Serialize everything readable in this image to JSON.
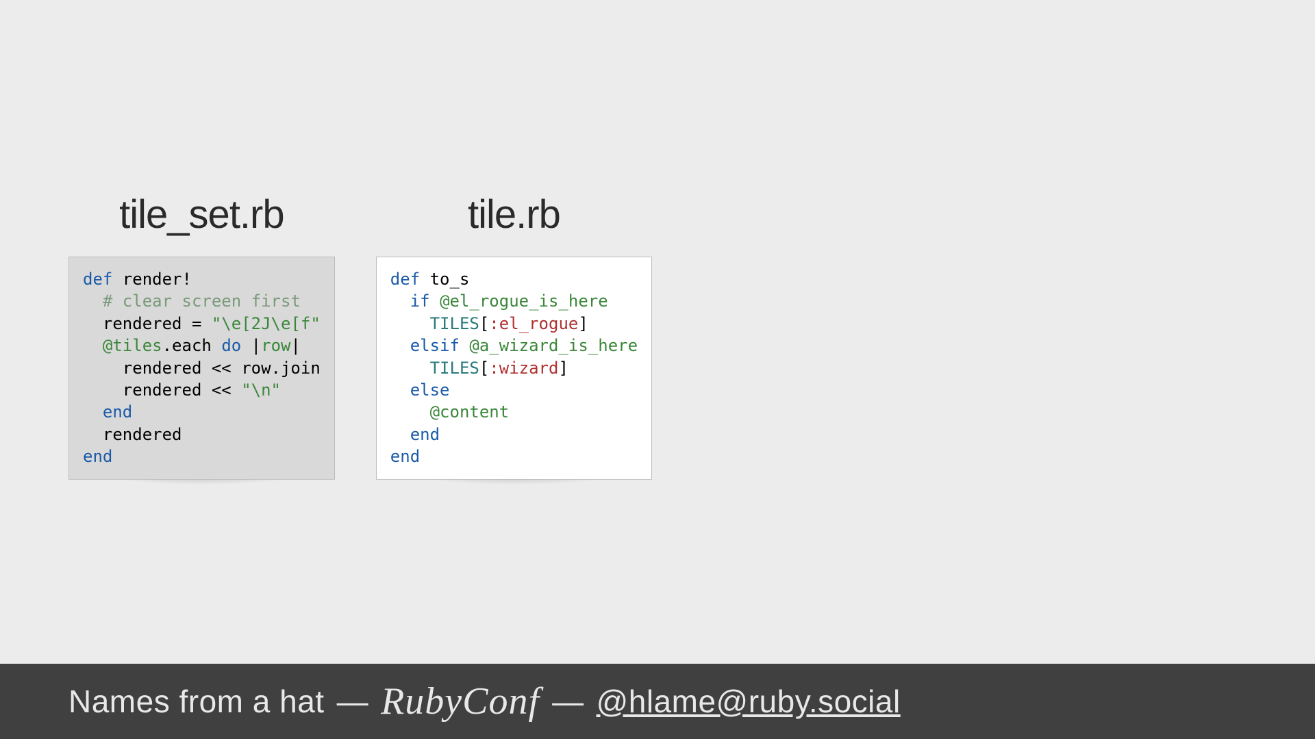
{
  "files": {
    "left": {
      "title": "tile_set.rb",
      "code_html": "<span class='kw'>def</span> render!\n  <span class='cm'># clear screen first</span>\n  rendered = <span class='str'>\"\\e[2J\\e[f\"</span>\n  <span class='ivar'>@tiles</span>.each <span class='kw'>do</span> |<span class='ivar'>row</span>|\n    rendered &lt;&lt; row.join\n    rendered &lt;&lt; <span class='str'>\"\\n\"</span>\n  <span class='kw'>end</span>\n  rendered\n<span class='kw'>end</span>"
    },
    "right": {
      "title": "tile.rb",
      "code_html": "<span class='kw'>def</span> to_s\n  <span class='kw'>if</span> <span class='ivar'>@el_rogue_is_here</span>\n    <span class='const'>TILES</span>[<span class='sym'>:el_rogue</span>]\n  <span class='kw'>elsif</span> <span class='ivar'>@a_wizard_is_here</span>\n    <span class='const'>TILES</span>[<span class='sym'>:wizard</span>]\n  <span class='kw'>else</span>\n    <span class='ivar'>@content</span>\n  <span class='kw'>end</span>\n<span class='kw'>end</span>"
    }
  },
  "footer": {
    "talk_title": "Names from a hat",
    "dash": "—",
    "conf": "RubyConf",
    "handle": "@hlame@ruby.social"
  }
}
